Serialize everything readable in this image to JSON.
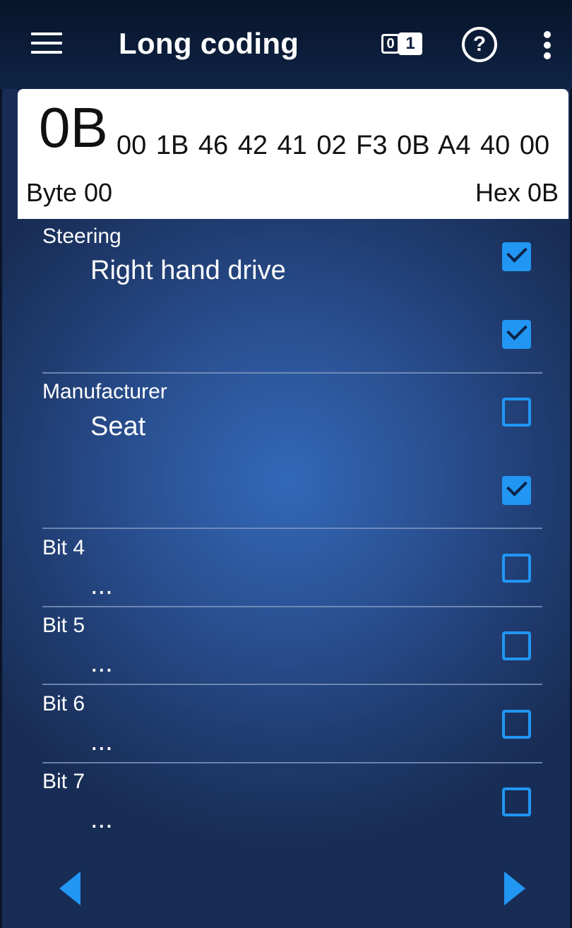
{
  "appbar": {
    "title": "Long coding",
    "menu_icon": "hamburger-menu-icon",
    "binary_icon": {
      "zero": "0",
      "one": "1"
    },
    "help_icon": "?",
    "more_icon": "more-vert-icon"
  },
  "coding": {
    "current_byte": "0B",
    "remaining_bytes": "00 1B 46 42 41 02 F3 0B A4 40 00",
    "byte_label": "Byte 00",
    "hex_label": "Hex 0B"
  },
  "groups": [
    {
      "label": "Steering",
      "value": "Right hand drive",
      "bits": [
        true,
        true
      ]
    },
    {
      "label": "Manufacturer",
      "value": "Seat",
      "bits": [
        false,
        true
      ]
    },
    {
      "label": "Bit 4",
      "value": "...",
      "bits": [
        false
      ]
    },
    {
      "label": "Bit 5",
      "value": "...",
      "bits": [
        false
      ]
    },
    {
      "label": "Bit 6",
      "value": "...",
      "bits": [
        false
      ]
    },
    {
      "label": "Bit 7",
      "value": "...",
      "bits": [
        false
      ]
    }
  ],
  "navigation": {
    "prev_icon": "triangle-left-icon",
    "next_icon": "triangle-right-icon"
  },
  "colors": {
    "accent": "#2196f3",
    "bar": "#0f2344",
    "card": "#ffffff"
  }
}
